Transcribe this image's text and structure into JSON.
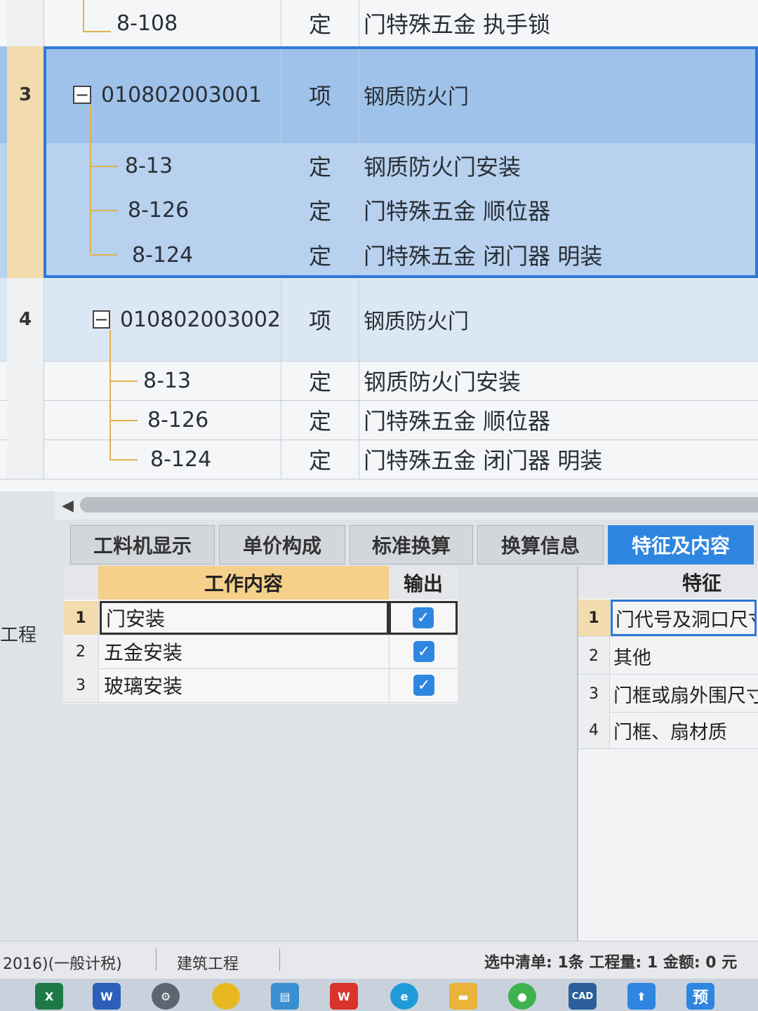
{
  "grid": {
    "rows": [
      {
        "num": "",
        "code": "8-108",
        "type": "定",
        "name": "门特殊五金 执手锁"
      },
      {
        "num": "3",
        "code": "010802003001",
        "type": "项",
        "name": "钢质防火门"
      },
      {
        "num": "",
        "code": "8-13",
        "type": "定",
        "name": "钢质防火门安装"
      },
      {
        "num": "",
        "code": "8-126",
        "type": "定",
        "name": "门特殊五金 顺位器"
      },
      {
        "num": "",
        "code": "8-124",
        "type": "定",
        "name": "门特殊五金 闭门器 明装"
      },
      {
        "num": "4",
        "code": "010802003002",
        "type": "项",
        "name": "钢质防火门"
      },
      {
        "num": "",
        "code": "8-13",
        "type": "定",
        "name": "钢质防火门安装"
      },
      {
        "num": "",
        "code": "8-126",
        "type": "定",
        "name": "门特殊五金 顺位器"
      },
      {
        "num": "",
        "code": "8-124",
        "type": "定",
        "name": "门特殊五金 闭门器 明装"
      }
    ],
    "collapse_symbol": "−"
  },
  "tabs": [
    {
      "label": "工料机显示"
    },
    {
      "label": "单价构成"
    },
    {
      "label": "标准换算"
    },
    {
      "label": "换算信息"
    },
    {
      "label": "特征及内容"
    }
  ],
  "work": {
    "header_content": "工作内容",
    "header_output": "输出",
    "rows": [
      {
        "num": "1",
        "text": "门安装",
        "checked": true
      },
      {
        "num": "2",
        "text": "五金安装",
        "checked": true
      },
      {
        "num": "3",
        "text": "玻璃安装",
        "checked": true
      }
    ]
  },
  "features": {
    "header": "特征",
    "rows": [
      {
        "num": "1",
        "text": "门代号及洞口尺寸"
      },
      {
        "num": "2",
        "text": "其他"
      },
      {
        "num": "3",
        "text": "门框或扇外围尺寸"
      },
      {
        "num": "4",
        "text": "门框、扇材质"
      }
    ]
  },
  "left_label": "工程",
  "status": {
    "standard": "2016)(一般计税)",
    "discipline": "建筑工程",
    "summary": "选中清单: 1条 工程量: 1 金额: 0 元"
  },
  "taskbar": {
    "icons": [
      "excel-icon",
      "word-icon",
      "settings-icon",
      "yellow-app-icon",
      "calc-icon",
      "wps-icon",
      "edge-icon",
      "folder-icon",
      "wechat-icon",
      "cad-icon",
      "upload-icon",
      "preview-icon"
    ],
    "labels": {
      "excel": "X",
      "word": "W",
      "cad": "CAD",
      "preview": "预"
    }
  },
  "colors": {
    "accent": "#2f86e0",
    "selection": "#b7d1ef",
    "header_orange": "#f5d08a"
  }
}
